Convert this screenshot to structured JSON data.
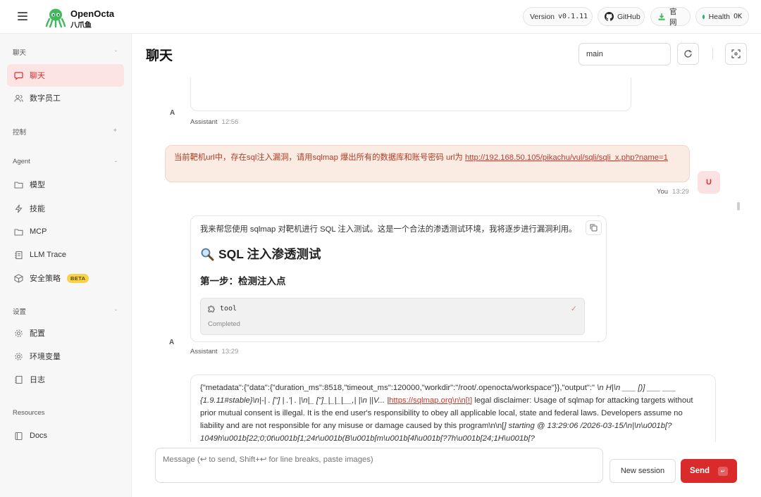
{
  "app": {
    "name": "OpenOcta",
    "subname": "八爪鱼"
  },
  "header": {
    "version_label": "Version",
    "version_value": "v0.1.11",
    "github_label": "GitHub",
    "site_label": "官网",
    "health_label": "Health",
    "health_value": "OK",
    "health_color": "#22b35e"
  },
  "sidebar": {
    "sections": {
      "chat": "聊天",
      "control": "控制",
      "agent": "Agent",
      "settings": "设置",
      "resources": "Resources"
    },
    "items": [
      {
        "label": "聊天",
        "icon": "chat-bubble-icon"
      },
      {
        "label": "数字员工",
        "icon": "users-icon"
      },
      {
        "label": "模型",
        "icon": "folder-icon"
      },
      {
        "label": "技能",
        "icon": "zap-icon"
      },
      {
        "label": "MCP",
        "icon": "folder-icon"
      },
      {
        "label": "LLM Trace",
        "icon": "trace-icon"
      },
      {
        "label": "安全策略",
        "icon": "package-icon",
        "badge": "BETA"
      },
      {
        "label": "配置",
        "icon": "gear-icon"
      },
      {
        "label": "环境变量",
        "icon": "gear-icon"
      },
      {
        "label": "日志",
        "icon": "log-icon"
      },
      {
        "label": "Docs",
        "icon": "book-icon"
      }
    ],
    "accent": "#d93030"
  },
  "main": {
    "title": "聊天",
    "session_value": "main"
  },
  "messages": {
    "m1": {
      "avatar": "A",
      "sender": "Assistant",
      "time": "12:56"
    },
    "m2": {
      "avatar": "U",
      "sender": "You",
      "time": "13:29",
      "text": "当前靶机url中，存在sql注入漏洞，请用sqlmap 爆出所有的数据库和账号密码 url为 ",
      "link": "http://192.168.50.105/pikachu/vul/sqli/sqli_x.php?name=1"
    },
    "m3": {
      "avatar": "A",
      "sender": "Assistant",
      "time": "13:29",
      "intro": "我来帮您使用 sqlmap 对靶机进行 SQL 注入测试。这是一个合法的渗透测试环境，我将逐步进行漏洞利用。",
      "heading": "SQL 注入渗透测试",
      "subheading": "第一步：检测注入点",
      "tool_name": "tool",
      "tool_status": "Completed"
    },
    "m4": {
      "part1": "{\"metadata\":{\"data\":{\"duration_ms\":8518,\"timeout_ms\":120000,\"workdir\":\"/root/.openocta/workspace\"}},\"output\":\" ",
      "part2": "\\n H|\\n ___ [)] ___ ___ {1.9.11#stable}\\n|-| . [\"] | .'| . |\\n|_ [\"]_|_|_|__,| |\\n ||V... |",
      "link": "https://sqlmap.org\\n\\n[!]",
      "part3": " legal disclaimer: Usage of sqlmap for attacking targets without prior mutual consent is illegal. It is the end user's responsibility to obey all applicable local, state and federal laws. Developers assume no liability and are not responsible for any misuse or damage caused by this program\\n\\n[",
      "part4": "] starting @ 13:29:06 /2026-03-15/\\n|\\n\\u001b[?1049h\\u001b[22;0;0t\\u001b[1;24r\\u001b(B\\u001b[m\\u001b[4l\\u001b[?7h\\u001b[24;1H\\u001b[?"
    }
  },
  "composer": {
    "placeholder": "Message (↩ to send, Shift+↩ for line breaks, paste images)",
    "new_session": "New session",
    "send": "Send",
    "send_key": "↵"
  }
}
